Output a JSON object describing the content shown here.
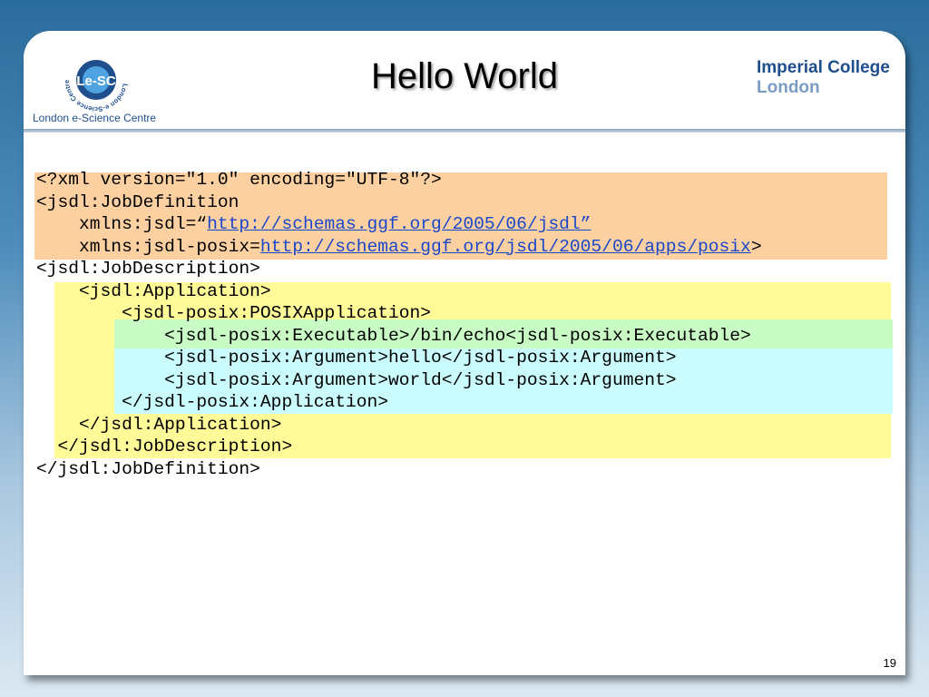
{
  "header": {
    "title": "Hello World",
    "lesc_caption": "London e-Science Centre",
    "imperial_line1": "Imperial College",
    "imperial_line2": "London"
  },
  "logo": {
    "lesc_text": "Le-SC",
    "lesc_ring_text": "London e-Science Centre"
  },
  "code": {
    "l1": "<?xml version=\"1.0\" encoding=\"UTF-8\"?>",
    "l2": "<jsdl:JobDefinition",
    "l3_pre": "    xmlns:jsdl=“",
    "l3_link": "http://schemas.ggf.org/2005/06/jsdl”",
    "l4_pre": "    xmlns:jsdl-posix=",
    "l4_link": "http://schemas.ggf.org/jsdl/2005/06/apps/posix",
    "l4_post": ">",
    "l5": "<jsdl:JobDescription>",
    "l6": "    <jsdl:Application>",
    "l7": "        <jsdl-posix:POSIXApplication>",
    "l8": "            <jsdl-posix:Executable>/bin/echo<jsdl-posix:Executable>",
    "l9": "            <jsdl-posix:Argument>hello</jsdl-posix:Argument>",
    "l10": "            <jsdl-posix:Argument>world</jsdl-posix:Argument>",
    "l11": "        </jsdl-posix:Application>",
    "l12": "    </jsdl:Application>",
    "l13": "  </jsdl:JobDescription>",
    "l14": "</jsdl:JobDefinition>"
  },
  "footer": {
    "page_number": "19"
  },
  "colors": {
    "orange_highlight": "#fdd0a2",
    "yellow_highlight": "#fffb98",
    "green_highlight": "#c8fcc4",
    "cyan_highlight": "#cafcfd",
    "link": "#1a47c9"
  }
}
